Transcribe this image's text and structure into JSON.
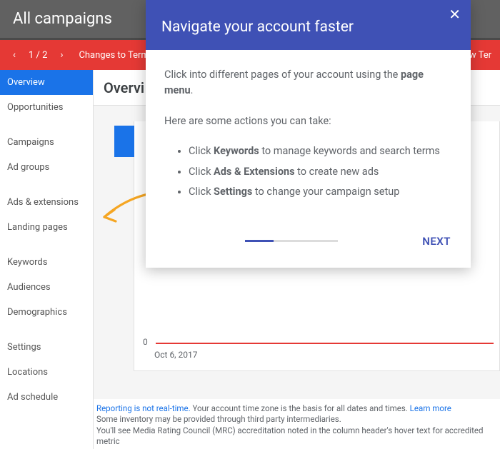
{
  "topbar": {
    "title": "All campaigns"
  },
  "notif": {
    "counter": "1 / 2",
    "message": "Changes to Terms",
    "tail": "ew Ter"
  },
  "sidebar": {
    "items": [
      "Overview",
      "Opportunities",
      "Campaigns",
      "Ad groups",
      "Ads & extensions",
      "Landing pages",
      "Keywords",
      "Audiences",
      "Demographics",
      "Settings",
      "Locations",
      "Ad schedule"
    ]
  },
  "main": {
    "title": "Overvi",
    "y0": "0",
    "xlabel": "Oct 6, 2017"
  },
  "footer": {
    "link1": "Reporting is not real-time.",
    "text1": " Your account time zone is the basis for all dates and times. ",
    "link2": "Learn more",
    "line2": "Some inventory may be provided through third party intermediaries.",
    "line3": "You'll see Media Rating Council (MRC) accreditation noted in the column header's hover text for accredited metric"
  },
  "modal": {
    "title": "Navigate your account faster",
    "intro_a": "Click into different pages of your account using the ",
    "intro_b_bold": "page menu",
    "intro_c": ".",
    "lead": "Here are some actions you can take:",
    "li1_a": "Click ",
    "li1_b": "Keywords",
    "li1_c": " to manage keywords and search terms",
    "li2_a": "Click ",
    "li2_b": "Ads & Extensions",
    "li2_c": " to create new ads",
    "li3_a": "Click ",
    "li3_b": "Settings",
    "li3_c": " to change your campaign setup",
    "next": "NEXT"
  }
}
